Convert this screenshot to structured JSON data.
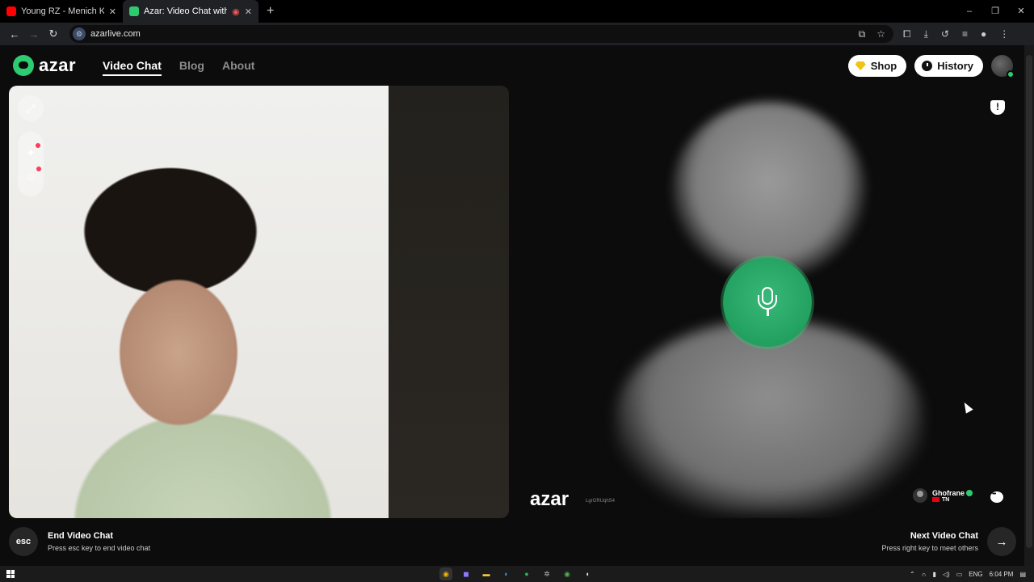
{
  "browser": {
    "tabs": [
      {
        "title": "Young RZ - Menich Kifek (Offic",
        "active": false,
        "favicon_color": "#ff0000"
      },
      {
        "title": "Azar: Video Chat with New",
        "active": true,
        "favicon_color": "#2ecc71"
      }
    ],
    "new_tab_glyph": "+",
    "window_controls": [
      "–",
      "❐",
      "✕"
    ],
    "url": "azarlive.com"
  },
  "site": {
    "logo_text": "azar",
    "nav": [
      {
        "label": "Video Chat",
        "active": true
      },
      {
        "label": "Blog",
        "active": false
      },
      {
        "label": "About",
        "active": false
      }
    ],
    "shop_label": "Shop",
    "history_label": "History"
  },
  "peer": {
    "logo_text": "azar",
    "id": "LgrGRUqhS4",
    "name": "Ghofrane",
    "country": "TN"
  },
  "bottom": {
    "esc_label": "esc",
    "end_title": "End Video Chat",
    "end_sub": "Press esc key to end video chat",
    "next_title": "Next Video Chat",
    "next_sub": "Press right key to meet others",
    "next_glyph": "→"
  },
  "taskbar": {
    "lang": "ENG",
    "time": "6:04 PM"
  },
  "colors": {
    "accent": "#2ecc71",
    "mic": "#22a060",
    "background": "#0c0c0c"
  }
}
